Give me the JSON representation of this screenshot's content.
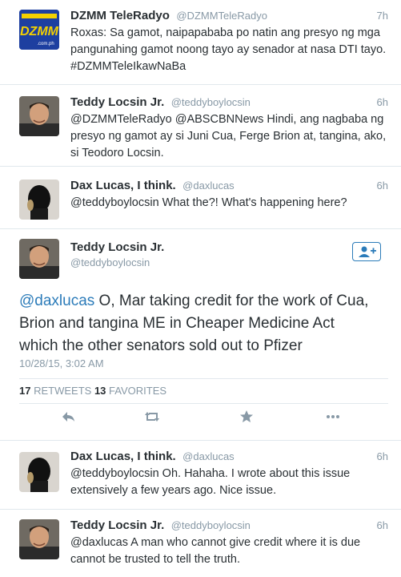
{
  "tweets": [
    {
      "name": "DZMM TeleRadyo",
      "handle": "@DZMMTeleRadyo",
      "time": "7h",
      "text": "Roxas: Sa gamot, naipapababa po natin ang presyo ng mga pangunahing gamot noong tayo ay senador at nasa DTI tayo. #DZMMTeleIkawNaBa"
    },
    {
      "name": "Teddy Locsin Jr.",
      "handle": "@teddyboylocsin",
      "time": "6h",
      "text": "@DZMMTeleRadyo @ABSCBNNews Hindi, ang nagbaba ng presyo ng gamot ay si Juni Cua, Ferge Brion at, tangina, ako, si Teodoro Locsin."
    },
    {
      "name": "Dax Lucas, I think.",
      "handle": "@daxlucas",
      "time": "6h",
      "text": "@teddyboylocsin What the?! What's happening here?"
    }
  ],
  "expanded": {
    "name": "Teddy Locsin Jr.",
    "handle": "@teddyboylocsin",
    "mention": "@daxlucas",
    "text": " O, Mar taking credit for the work of Cua, Brion and tangina ME in Cheaper Medicine Act which the other senators sold out to Pfizer",
    "timestamp": "10/28/15, 3:02 AM",
    "retweets_count": "17",
    "retweets_label": "RETWEETS",
    "favorites_count": "13",
    "favorites_label": "FAVORITES"
  },
  "replies": [
    {
      "name": "Dax Lucas, I think.",
      "handle": "@daxlucas",
      "time": "6h",
      "text": "@teddyboylocsin Oh. Hahaha. I wrote about this issue extensively a few years ago. Nice issue."
    },
    {
      "name": "Teddy Locsin Jr.",
      "handle": "@teddyboylocsin",
      "time": "6h",
      "text": "@daxlucas A man who cannot give credit where it is due cannot be trusted to tell the truth."
    }
  ],
  "logo": {
    "main": "DZMM",
    "sub": ".com.ph"
  },
  "colors": {
    "link": "#2b7bb9",
    "muted": "#8899a6",
    "text": "#292f33",
    "border": "#e1e8ed",
    "dzmm_blue": "#1d3fa0",
    "dzmm_yellow": "#f4d000"
  },
  "icons": [
    "reply-icon",
    "retweet-icon",
    "favorite-icon",
    "more-icon",
    "follow-user-icon"
  ]
}
